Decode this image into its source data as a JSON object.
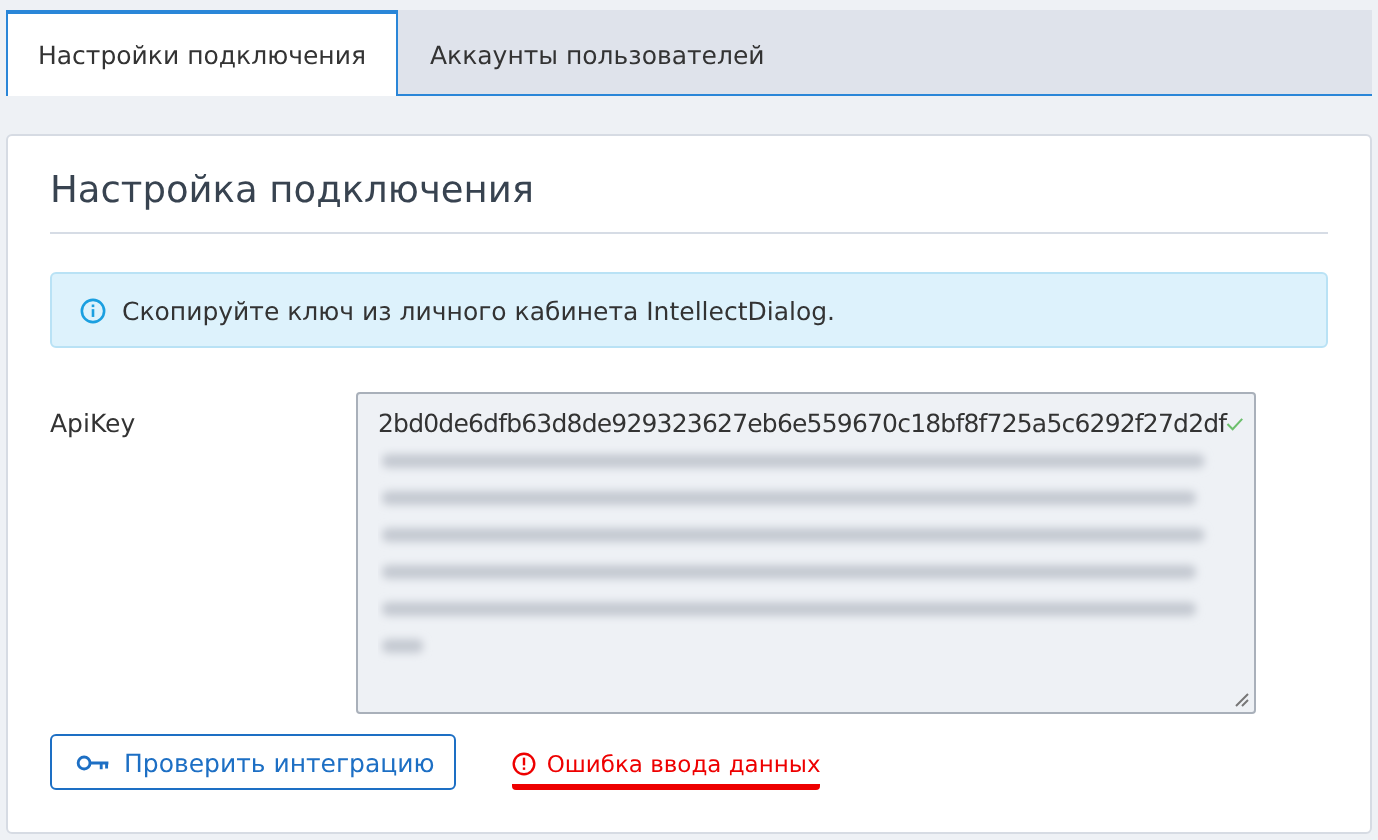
{
  "tabs": [
    {
      "label": "Настройки подключения",
      "selected": true
    },
    {
      "label": "Аккаунты пользователей",
      "selected": false
    }
  ],
  "panel": {
    "title": "Настройка подключения",
    "alert": {
      "text": "Скопируйте ключ из личного кабинета IntellectDialog."
    },
    "api_key": {
      "label": "ApiKey",
      "value": "2bd0de6dfb63d8de929323627eb6e559670c18bf8f725a5c6292f27d2df",
      "valid": true
    },
    "check_button": {
      "label": "Проверить интеграцию"
    },
    "error": {
      "text": "Ошибка ввода данных",
      "underlined": true
    }
  }
}
